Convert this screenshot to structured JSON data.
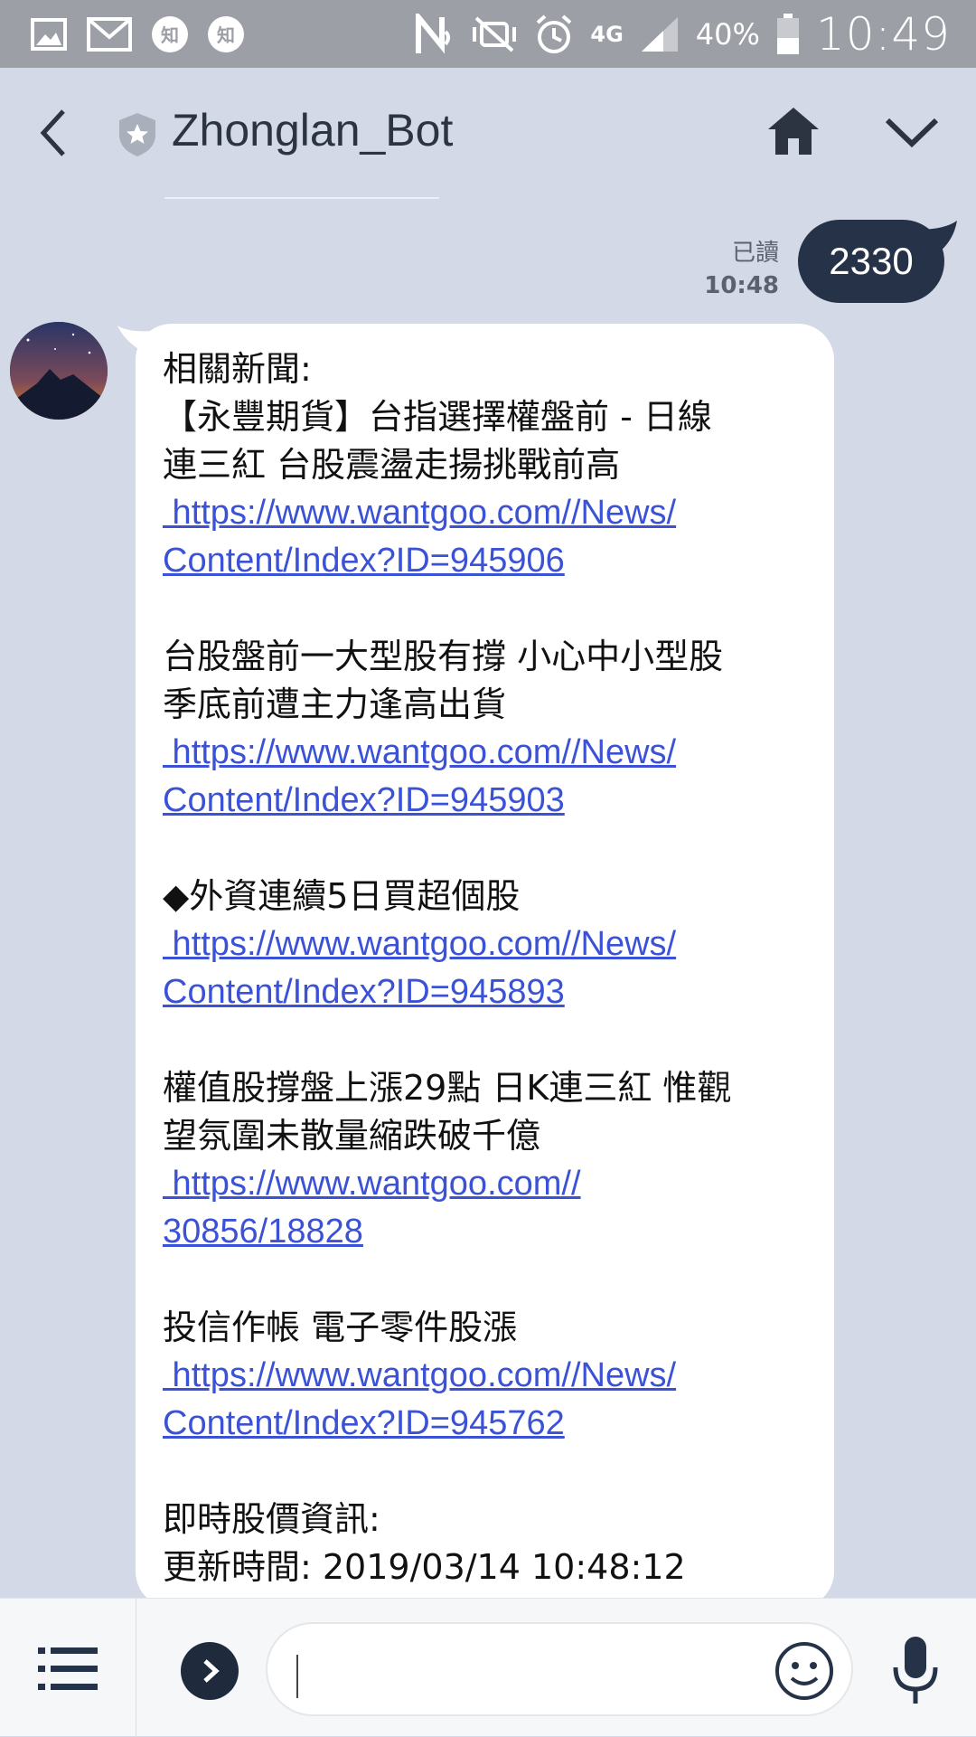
{
  "status_bar": {
    "icons_left": [
      "gallery-icon",
      "gmail-icon",
      "zhihu-icon",
      "zhihu-icon"
    ],
    "zhihu_glyph": "知",
    "icons_right": [
      "nfc-icon",
      "mute-icon",
      "alarm-icon",
      "network-4g-icon",
      "signal-icon",
      "battery-icon"
    ],
    "network": "4G",
    "battery": "40%",
    "time": "10:49"
  },
  "header": {
    "title": "Zhonglan_Bot",
    "icons": [
      "back-icon",
      "shield-star-icon",
      "home-icon",
      "chevron-down-icon"
    ]
  },
  "sent_message": {
    "read_label": "已讀",
    "time": "10:48",
    "text": "2330"
  },
  "bot_message": {
    "heading": "相關新聞:",
    "news": [
      {
        "title_lines": [
          "【永豐期貨】台指選擇權盤前 - 日線",
          "連三紅 台股震盪走揚挑戰前高"
        ],
        "link_lines": [
          " https://www.wantgoo.com//News/",
          "Content/Index?ID=945906"
        ]
      },
      {
        "title_lines": [
          "台股盤前一大型股有撐 小心中小型股",
          "季底前遭主力逢高出貨"
        ],
        "link_lines": [
          " https://www.wantgoo.com//News/",
          "Content/Index?ID=945903"
        ]
      },
      {
        "title_lines": [
          "◆外資連續5日買超個股"
        ],
        "link_lines": [
          " https://www.wantgoo.com//News/",
          "Content/Index?ID=945893"
        ]
      },
      {
        "title_lines": [
          "權值股撐盤上漲29點 日K連三紅 惟觀",
          "望氛圍未散量縮跌破千億"
        ],
        "link_lines": [
          " https://www.wantgoo.com//",
          "30856/18828"
        ]
      },
      {
        "title_lines": [
          "投信作帳 電子零件股漲"
        ],
        "link_lines": [
          " https://www.wantgoo.com//News/",
          "Content/Index?ID=945762"
        ]
      }
    ],
    "stock_heading": "即時股價資訊:",
    "update_time": "更新時間: 2019/03/14 10:48:12"
  },
  "bottom_bar": {
    "icons": [
      "menu-icon",
      "expand-arrow-icon",
      "emoji-icon",
      "microphone-icon"
    ],
    "input_value": ""
  },
  "colors": {
    "status_bar": "#9c9fa6",
    "background": "#d3d9e6",
    "sent_bubble": "#263247",
    "link": "#3b52d6",
    "title_text": "#2c3442"
  }
}
